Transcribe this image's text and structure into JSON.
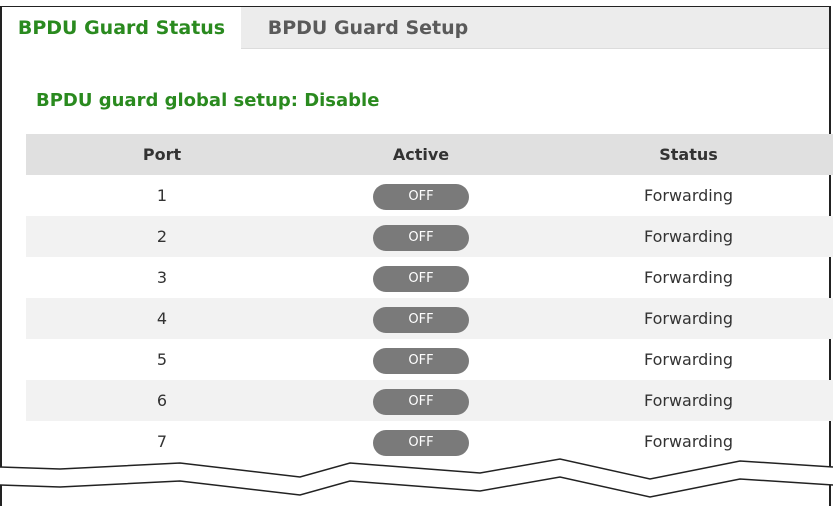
{
  "tabs": [
    {
      "label": "BPDU Guard Status",
      "active": true
    },
    {
      "label": "BPDU Guard Setup",
      "active": false
    }
  ],
  "global_setup_text": "BPDU guard global setup: Disable",
  "table": {
    "headers": {
      "port": "Port",
      "active": "Active",
      "status": "Status"
    },
    "rows": [
      {
        "port": "1",
        "active": "OFF",
        "status": "Forwarding"
      },
      {
        "port": "2",
        "active": "OFF",
        "status": "Forwarding"
      },
      {
        "port": "3",
        "active": "OFF",
        "status": "Forwarding"
      },
      {
        "port": "4",
        "active": "OFF",
        "status": "Forwarding"
      },
      {
        "port": "5",
        "active": "OFF",
        "status": "Forwarding"
      },
      {
        "port": "6",
        "active": "OFF",
        "status": "Forwarding"
      },
      {
        "port": "7",
        "active": "OFF",
        "status": "Forwarding"
      }
    ]
  },
  "colors": {
    "accent_green": "#2a8a1f",
    "toggle_off": "#7a7a7a",
    "header_bg": "#e0e0e0"
  }
}
